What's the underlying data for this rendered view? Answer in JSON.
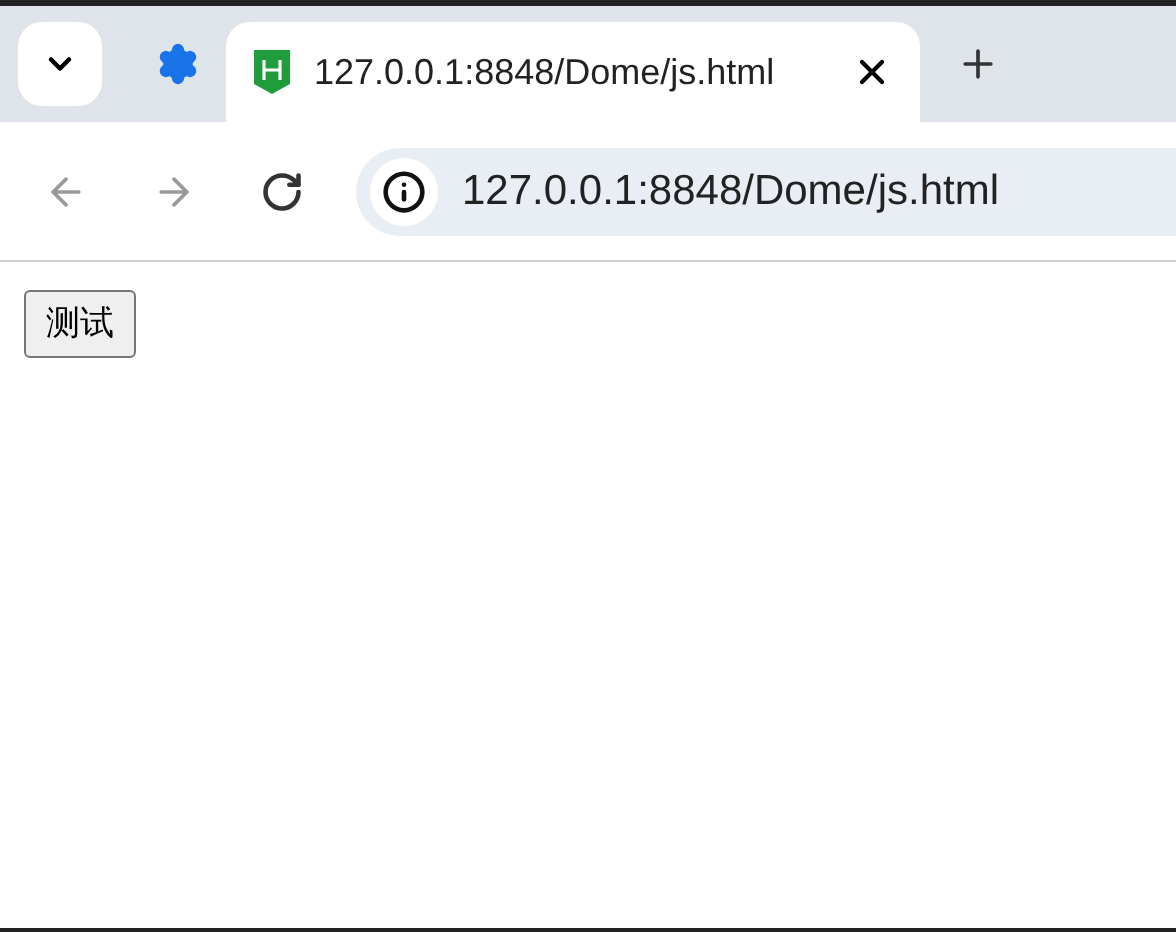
{
  "tabs": [
    {
      "title": "127.0.0.1:8848/Dome/js.html",
      "selected": true
    }
  ],
  "address_bar": {
    "url": "127.0.0.1:8848/Dome/js.html"
  },
  "page": {
    "button": "测试"
  }
}
